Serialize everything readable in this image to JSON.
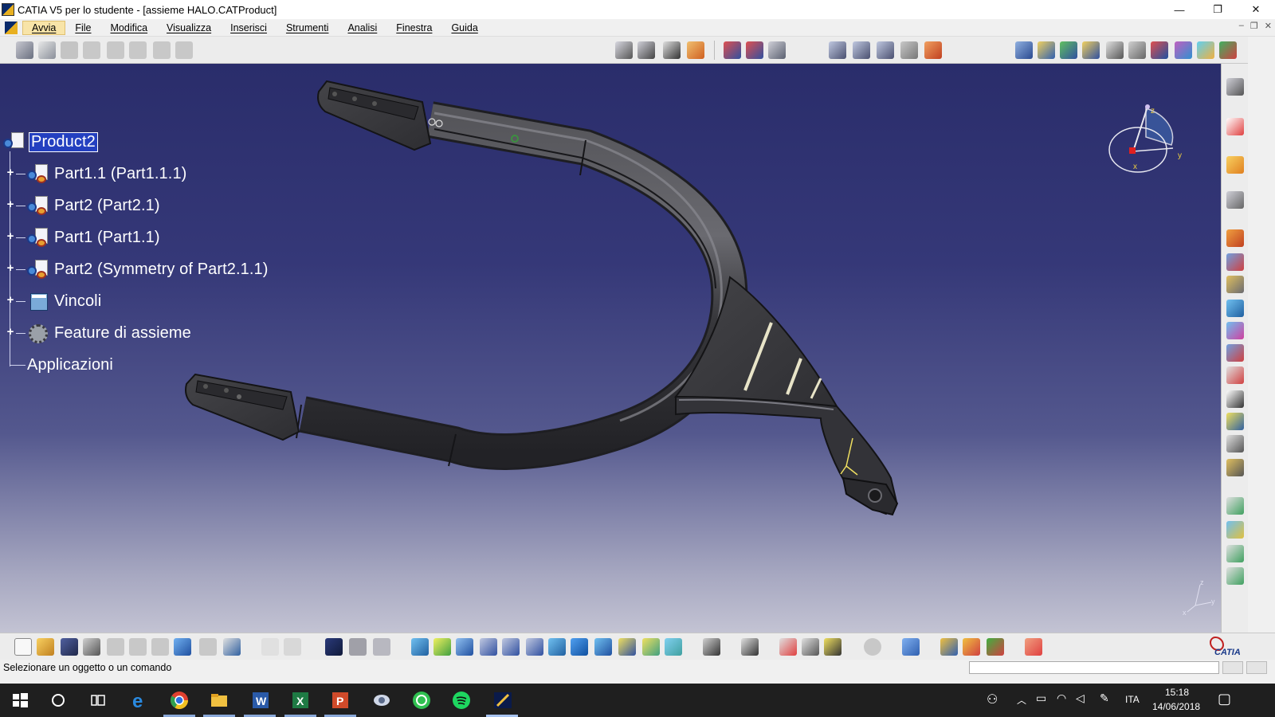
{
  "window": {
    "title": "CATIA V5 per lo studente - [assieme HALO.CATProduct]",
    "controls": {
      "minimize": "—",
      "restore": "❐",
      "close": "✕"
    }
  },
  "menu": {
    "items": [
      "Avvia",
      "File",
      "Modifica",
      "Visualizza",
      "Inserisci",
      "Strumenti",
      "Analisi",
      "Finestra",
      "Guida"
    ],
    "active": "Avvia",
    "mdi": {
      "minimize": "–",
      "restore": "❐",
      "close": "✕"
    }
  },
  "tree": {
    "root": "Product2",
    "children": [
      {
        "label": "Part1.1 (Part1.1.1)",
        "type": "part"
      },
      {
        "label": "Part2 (Part2.1)",
        "type": "part"
      },
      {
        "label": "Part1 (Part1.1)",
        "type": "part"
      },
      {
        "label": "Part2 (Symmetry of Part2.1.1)",
        "type": "part"
      },
      {
        "label": "Vincoli",
        "type": "constraints"
      },
      {
        "label": "Feature di assieme",
        "type": "features"
      },
      {
        "label": "Applicazioni",
        "type": "applications"
      }
    ],
    "expander": "+"
  },
  "compass": {
    "x": "x",
    "y": "y",
    "z": "z"
  },
  "axis_triad": {
    "x": "x",
    "y": "y",
    "z": "z"
  },
  "status": {
    "message": "Selezionare un oggetto o un comando"
  },
  "brand": {
    "logo": "CATIA"
  },
  "taskbar": {
    "time": "15:18",
    "date": "14/06/2018",
    "language": "ITA",
    "apps": [
      "start-icon",
      "cortana-icon",
      "task-view-icon",
      "edge-icon",
      "chrome-icon",
      "file-explorer-icon",
      "word-icon",
      "excel-icon",
      "powerpoint-icon",
      "app-icon",
      "whatsapp-icon",
      "spotify-icon",
      "catia-icon"
    ]
  },
  "colors": {
    "viewport_top": "#2a2d6b",
    "viewport_bottom": "#c3c3d3",
    "selection": "#2440c0",
    "model": "#3a3a3e",
    "active_menu": "#f8e4a8"
  }
}
